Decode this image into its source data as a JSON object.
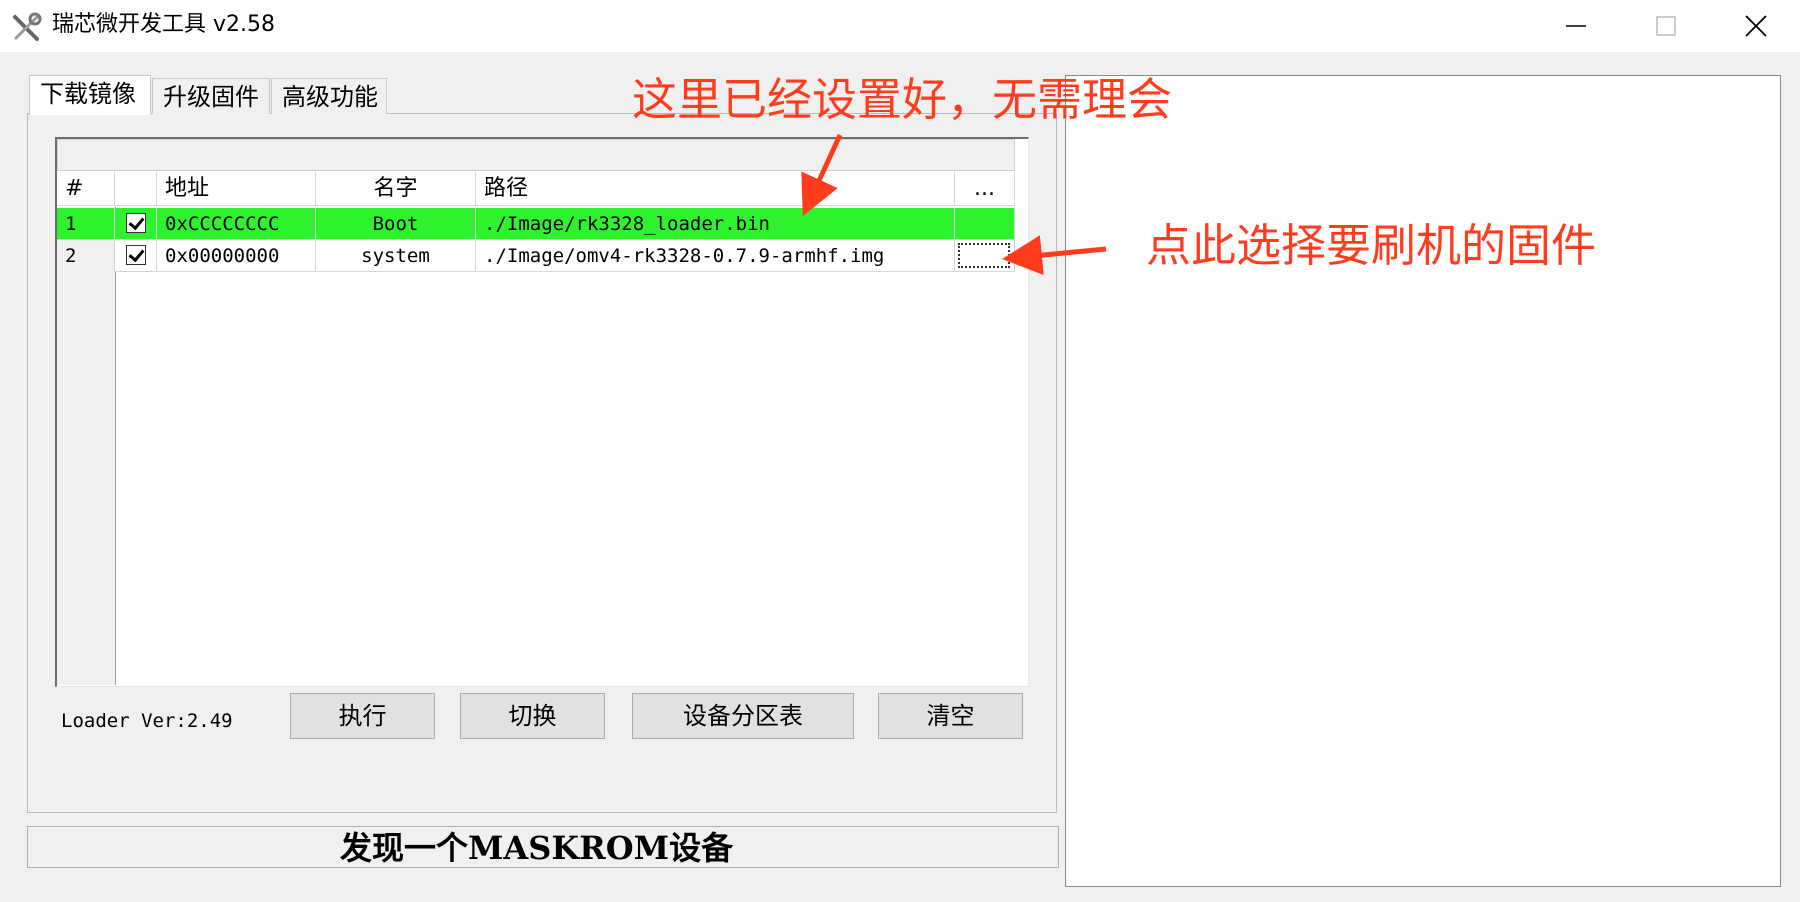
{
  "window": {
    "title": "瑞芯微开发工具 v2.58",
    "icon": "tools-icon"
  },
  "tabs": [
    {
      "label": "下载镜像",
      "active": true
    },
    {
      "label": "升级固件",
      "active": false
    },
    {
      "label": "高级功能",
      "active": false
    }
  ],
  "table": {
    "headers": [
      "#",
      "",
      "地址",
      "名字",
      "路径",
      "..."
    ],
    "rows": [
      {
        "num": "1",
        "checked": true,
        "address": "0xCCCCCCCC",
        "name": "Boot",
        "path": "./Image/rk3328_loader.bin",
        "highlight": "#2ef22e"
      },
      {
        "num": "2",
        "checked": true,
        "address": "0x00000000",
        "name": "system",
        "path": "./Image/omv4-rk3328-0.7.9-armhf.img",
        "highlight": "#ffffff"
      }
    ]
  },
  "loader_version": "Loader Ver:2.49",
  "buttons": {
    "execute": "执行",
    "switch": "切换",
    "partition_table": "设备分区表",
    "clear": "清空"
  },
  "status": "发现一个MASKROM设备",
  "annotations": {
    "top": "这里已经设置好，无需理会",
    "right": "点此选择要刷机的固件",
    "color": "#ff3c1e"
  }
}
